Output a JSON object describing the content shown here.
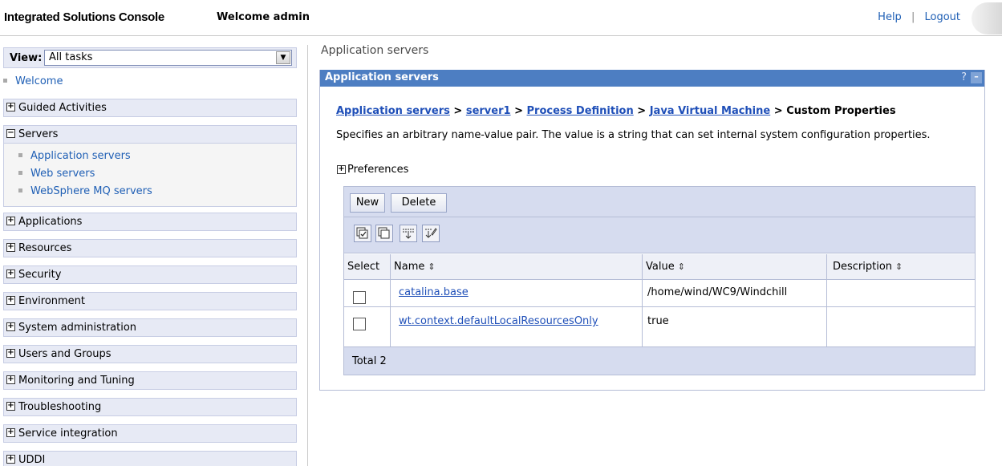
{
  "header": {
    "app_title": "Integrated Solutions Console",
    "welcome": "Welcome admin",
    "help": "Help",
    "separator": "|",
    "logout": "Logout"
  },
  "nav": {
    "view_label": "View:",
    "view_value": "All tasks",
    "welcome_link": "Welcome",
    "groups": [
      {
        "label": "Guided Activities",
        "expanded": false
      },
      {
        "label": "Servers",
        "expanded": true
      },
      {
        "label": "Applications",
        "expanded": false
      },
      {
        "label": "Resources",
        "expanded": false
      },
      {
        "label": "Security",
        "expanded": false
      },
      {
        "label": "Environment",
        "expanded": false
      },
      {
        "label": "System administration",
        "expanded": false
      },
      {
        "label": "Users and Groups",
        "expanded": false
      },
      {
        "label": "Monitoring and Tuning",
        "expanded": false
      },
      {
        "label": "Troubleshooting",
        "expanded": false
      },
      {
        "label": "Service integration",
        "expanded": false
      },
      {
        "label": "UDDI",
        "expanded": false
      }
    ],
    "servers_items": [
      "Application servers",
      "Web servers",
      "WebSphere MQ servers"
    ]
  },
  "main": {
    "page_title": "Application servers",
    "panel_title": "Application servers",
    "help_mark": "?",
    "minimize_mark": "–",
    "breadcrumb": {
      "links": [
        "Application servers",
        "server1",
        "Process Definition",
        "Java Virtual Machine"
      ],
      "sep": ">",
      "current": "Custom Properties"
    },
    "description": "Specifies an arbitrary name-value pair. The value is a string that can set internal system configuration properties.",
    "preferences": "Preferences",
    "buttons": {
      "new": "New",
      "delete": "Delete"
    },
    "icons": [
      "select-all-icon",
      "deselect-all-icon",
      "show-filter-icon",
      "clear-filter-icon"
    ],
    "table": {
      "headers": {
        "select": "Select",
        "name": "Name",
        "value": "Value",
        "description": "Description"
      },
      "sort_glyph": "⇕",
      "rows": [
        {
          "name": "catalina.base",
          "value": "/home/wind/WC9/Windchill",
          "description": ""
        },
        {
          "name": "wt.context.defaultLocalResourcesOnly",
          "value": "true",
          "description": ""
        }
      ],
      "total": "Total 2"
    },
    "colors": {
      "panel_header": "#4d7ec2",
      "link": "#1f4fb8",
      "bar": "#d6dcef"
    }
  }
}
